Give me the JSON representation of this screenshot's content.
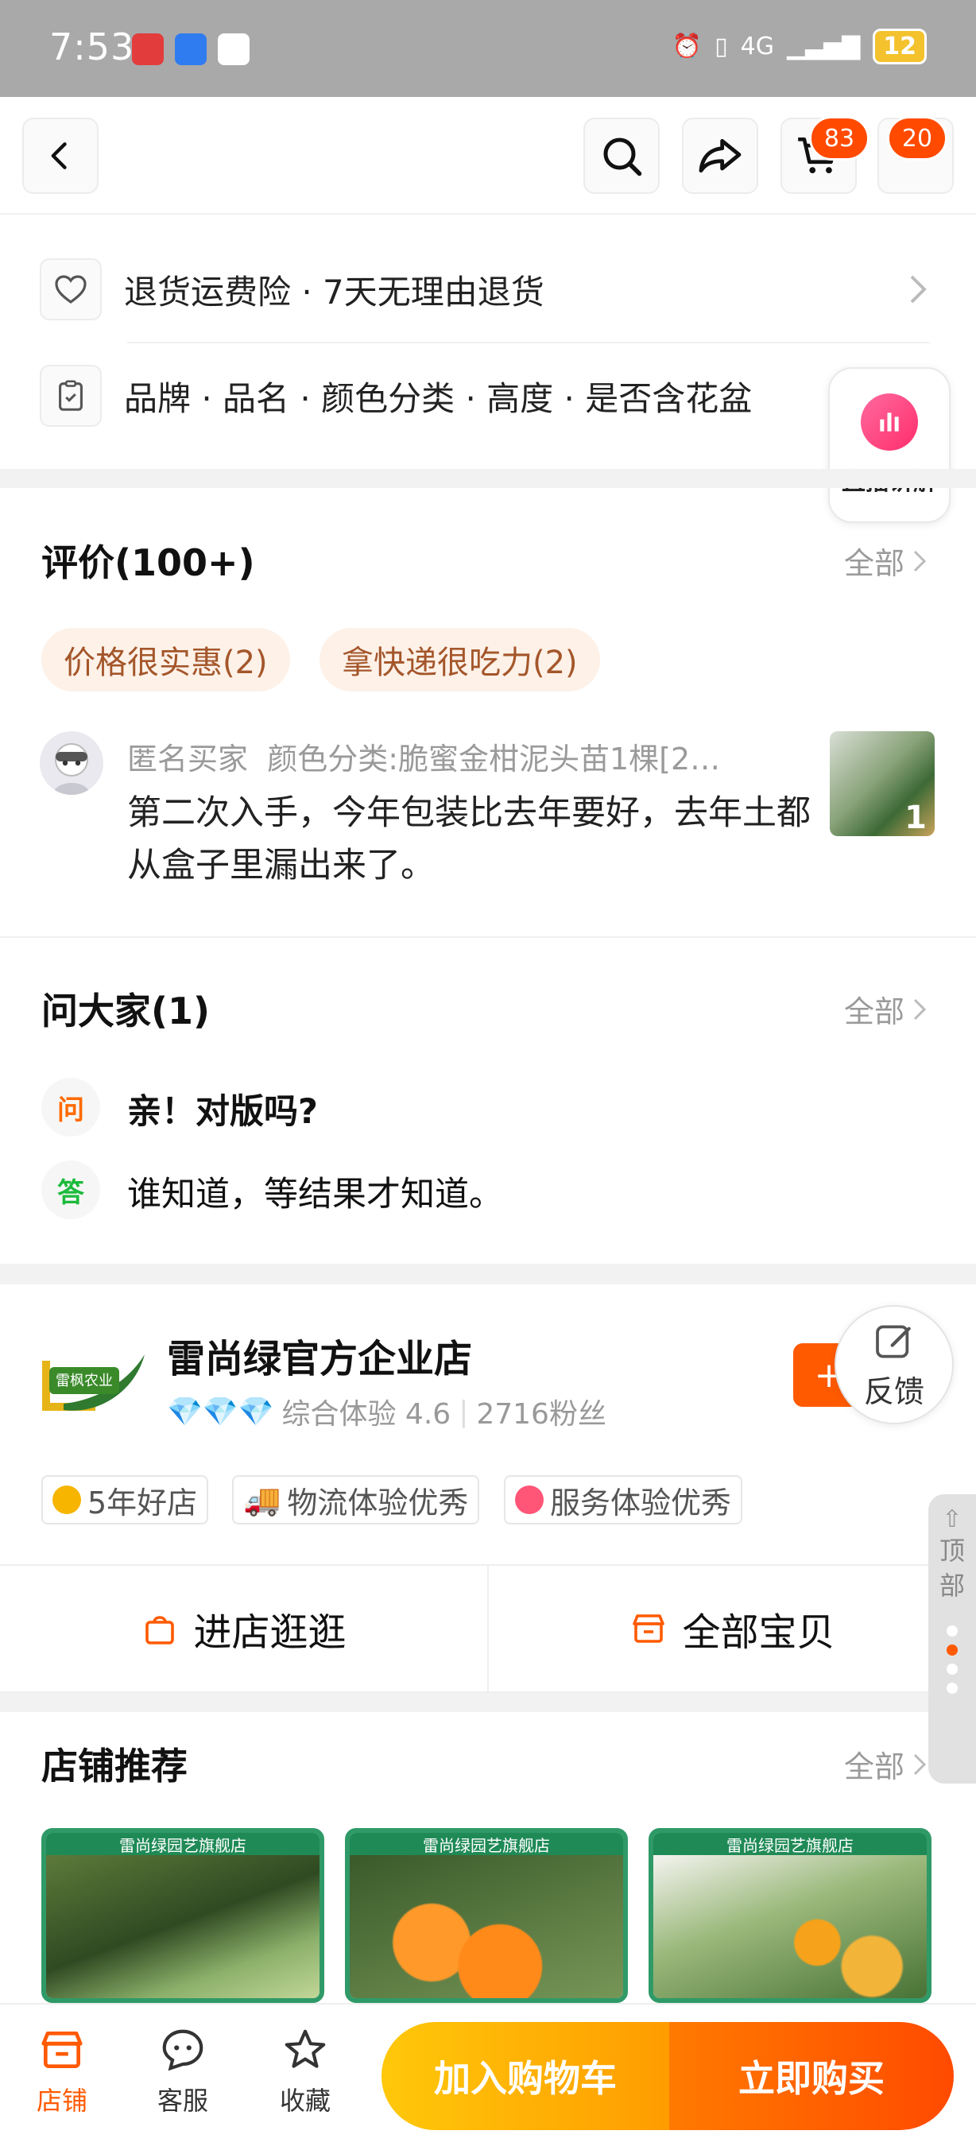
{
  "status_bar": {
    "time": "7:53",
    "network": "4G",
    "battery": "12"
  },
  "nav": {
    "cart_badge": "83",
    "more_badge": "20"
  },
  "services": {
    "return_text": "退货运费险 · 7天无理由退货",
    "params_text": "品牌 · 品名 · 颜色分类 · 高度 · 是否含花盆"
  },
  "live": {
    "label": "直播讲解"
  },
  "reviews": {
    "title": "评价(100+)",
    "all_label": "全部",
    "tags": [
      "价格很实惠(2)",
      "拿快递很吃力(2)"
    ],
    "items": [
      {
        "user": "匿名买家",
        "variant": "颜色分类:脆蜜金柑泥头苗1棵[2…",
        "text": "第二次入手，今年包装比去年要好，去年土都从盒子里漏出来了。",
        "image_count": "1"
      }
    ]
  },
  "qa": {
    "title": "问大家(1)",
    "all_label": "全部",
    "question_badge": "问",
    "answer_badge": "答",
    "question": "亲！对版吗?",
    "answer": "谁知道，等结果才知道。"
  },
  "store": {
    "name": "雷尚绿官方企业店",
    "logo_text": "雷枫农业",
    "rating_label": "综合体验 4.6",
    "fans": "2716粉丝",
    "follow_label": "+",
    "badges": [
      "5年好店",
      "物流体验优秀",
      "服务体验优秀"
    ],
    "enter_label": "进店逛逛",
    "all_items_label": "全部宝贝"
  },
  "feedback": {
    "label": "反馈"
  },
  "back_to_top": {
    "label": "顶部"
  },
  "recommend": {
    "title": "店铺推荐",
    "all_label": "全部",
    "card_header": "雷尚绿园艺旗舰店"
  },
  "bottom_bar": {
    "shop": "店铺",
    "service": "客服",
    "favorite": "收藏",
    "add_cart": "加入购物车",
    "buy_now": "立即购买"
  },
  "colors": {
    "accent": "#ff5a00",
    "cart_gradient_start": "#ffc80a",
    "buy_gradient_end": "#ff4a00"
  }
}
